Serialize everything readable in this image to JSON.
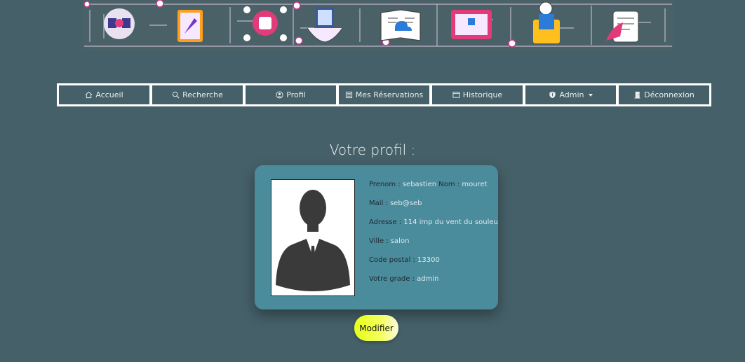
{
  "nav": {
    "items": [
      {
        "label": "Accueil",
        "icon": "home-icon"
      },
      {
        "label": "Recherche",
        "icon": "search-icon"
      },
      {
        "label": "Profil",
        "icon": "user-circle-icon"
      },
      {
        "label": "Mes Réservations",
        "icon": "list-icon"
      },
      {
        "label": "Historique",
        "icon": "window-icon"
      },
      {
        "label": "Admin",
        "icon": "shield-icon"
      },
      {
        "label": "Déconnexion",
        "icon": "door-icon"
      }
    ]
  },
  "page": {
    "title": "Votre profil :"
  },
  "profile": {
    "prenom_label": "Prenom :",
    "prenom_value": "sebastien",
    "nom_label": "Nom :",
    "nom_value": "mouret",
    "mail_label": "Mail :",
    "mail_value": "seb@seb",
    "adresse_label": "Adresse :",
    "adresse_value": "114 imp du vent du souleu",
    "ville_label": "Ville :",
    "ville_value": "salon",
    "code_label": "Code postal :",
    "code_value": "13300",
    "grade_label": "Votre grade :",
    "grade_value": "admin"
  },
  "actions": {
    "modify_label": "Modifier"
  },
  "colors": {
    "background": "#456068",
    "card": "#4a8b9c",
    "button_accent": "#e7ff1a"
  }
}
